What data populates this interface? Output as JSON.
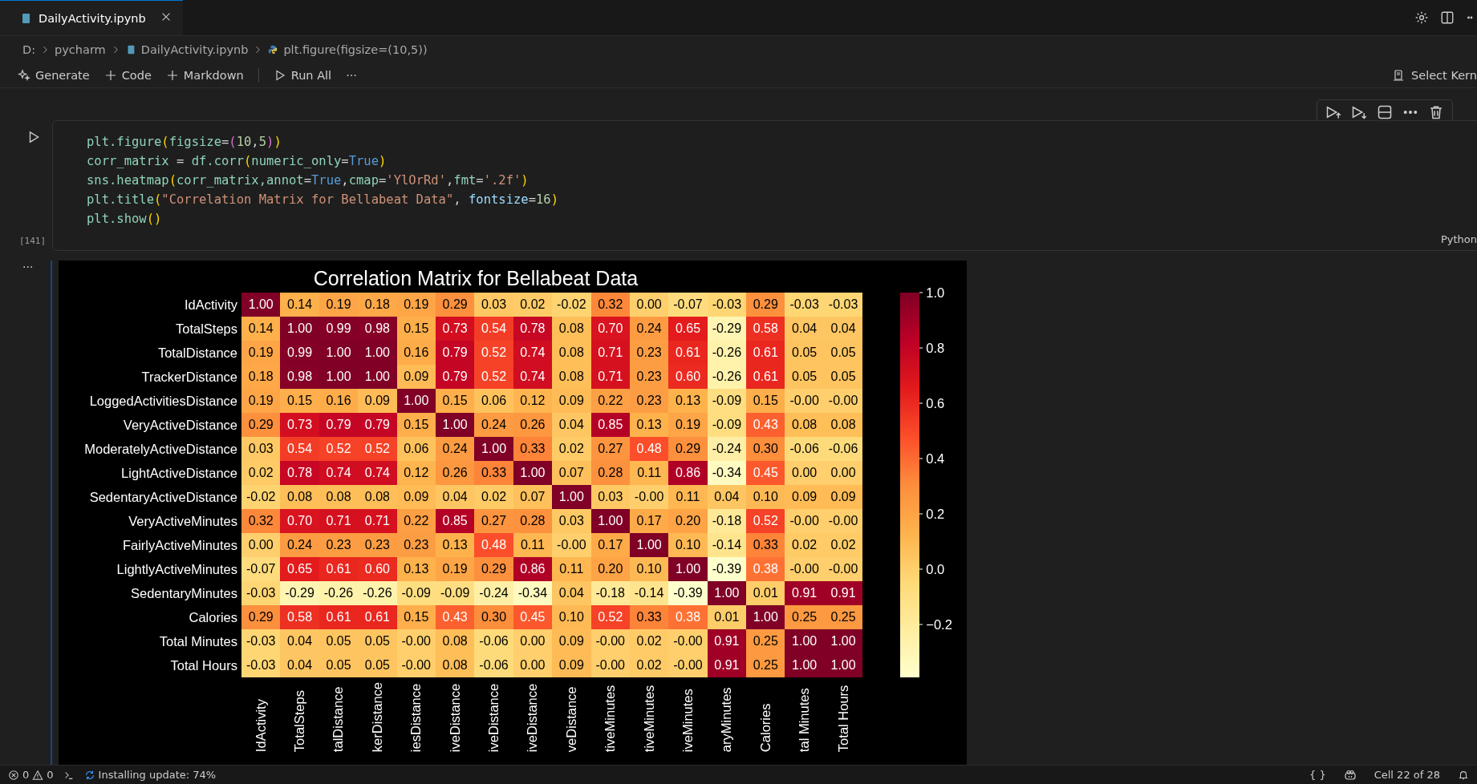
{
  "tabs": [
    {
      "label": "DailyActivity.ipynb",
      "selected": true
    }
  ],
  "breadcrumb": [
    "D:",
    "pycharm",
    "DailyActivity.ipynb",
    "plt.figure(figsize=(10,5))"
  ],
  "toolbar": {
    "items": [
      {
        "kind": "sparkle",
        "label": "Generate"
      },
      {
        "kind": "plus",
        "label": "Code"
      },
      {
        "kind": "plus",
        "label": "Markdown"
      },
      {
        "kind": "run",
        "label": "Run All"
      },
      {
        "kind": "more",
        "label": "···"
      }
    ],
    "kernel": "Select Kern"
  },
  "cell": {
    "execution_count": "[141]",
    "language": "Python",
    "code": [
      [
        {
          "kind": "ident",
          "text": "plt.figure"
        },
        {
          "kind": "paren",
          "text": "("
        },
        {
          "kind": "ident",
          "text": "figsize"
        },
        {
          "kind": "op",
          "text": "="
        },
        {
          "kind": "paren2",
          "text": "("
        },
        {
          "kind": "num",
          "text": "10"
        },
        {
          "kind": "op",
          "text": ","
        },
        {
          "kind": "num",
          "text": "5"
        },
        {
          "kind": "paren2",
          "text": ")"
        },
        {
          "kind": "paren",
          "text": ")"
        }
      ],
      [
        {
          "kind": "ident",
          "text": "corr_matrix"
        },
        {
          "kind": "op",
          "text": " = "
        },
        {
          "kind": "ident",
          "text": "df.corr"
        },
        {
          "kind": "paren",
          "text": "("
        },
        {
          "kind": "ident",
          "text": "numeric_only"
        },
        {
          "kind": "op",
          "text": "="
        },
        {
          "kind": "kw",
          "text": "True"
        },
        {
          "kind": "paren",
          "text": ")"
        }
      ],
      [
        {
          "kind": "ident",
          "text": "sns.heatmap"
        },
        {
          "kind": "paren",
          "text": "("
        },
        {
          "kind": "ident",
          "text": "corr_matrix,annot"
        },
        {
          "kind": "op",
          "text": "="
        },
        {
          "kind": "kw",
          "text": "True"
        },
        {
          "kind": "op",
          "text": ","
        },
        {
          "kind": "ident",
          "text": "cmap"
        },
        {
          "kind": "op",
          "text": "="
        },
        {
          "kind": "str",
          "text": "'YlOrRd'"
        },
        {
          "kind": "op",
          "text": ","
        },
        {
          "kind": "ident",
          "text": "fmt"
        },
        {
          "kind": "op",
          "text": "="
        },
        {
          "kind": "str",
          "text": "'.2f'"
        },
        {
          "kind": "paren",
          "text": ")"
        }
      ],
      [
        {
          "kind": "ident",
          "text": "plt.title"
        },
        {
          "kind": "paren",
          "text": "("
        },
        {
          "kind": "str",
          "text": "\"Correlation Matrix for Bellabeat Data\""
        },
        {
          "kind": "op",
          "text": ", "
        },
        {
          "kind": "param",
          "text": "fontsize"
        },
        {
          "kind": "op",
          "text": "="
        },
        {
          "kind": "num",
          "text": "16"
        },
        {
          "kind": "paren",
          "text": ")"
        }
      ],
      [
        {
          "kind": "ident",
          "text": "plt.show"
        },
        {
          "kind": "paren",
          "text": "()"
        }
      ]
    ]
  },
  "output": {
    "more": "···",
    "heatmap": {
      "title": "Correlation Matrix for Bellabeat Data",
      "rows": [
        {
          "label": "IdActivity",
          "values": [
            "1.00",
            "0.14",
            "0.19",
            "0.18",
            "0.19",
            "0.29",
            "0.03",
            "0.02",
            "-0.02",
            "0.32",
            "0.00",
            "-0.07",
            "-0.03",
            "0.29",
            "-0.03",
            "-0.03"
          ]
        },
        {
          "label": "TotalSteps",
          "values": [
            "0.14",
            "1.00",
            "0.99",
            "0.98",
            "0.15",
            "0.73",
            "0.54",
            "0.78",
            "0.08",
            "0.70",
            "0.24",
            "0.65",
            "-0.29",
            "0.58",
            "0.04",
            "0.04"
          ]
        },
        {
          "label": "TotalDistance",
          "values": [
            "0.19",
            "0.99",
            "1.00",
            "1.00",
            "0.16",
            "0.79",
            "0.52",
            "0.74",
            "0.08",
            "0.71",
            "0.23",
            "0.61",
            "-0.26",
            "0.61",
            "0.05",
            "0.05"
          ]
        },
        {
          "label": "TrackerDistance",
          "values": [
            "0.18",
            "0.98",
            "1.00",
            "1.00",
            "0.09",
            "0.79",
            "0.52",
            "0.74",
            "0.08",
            "0.71",
            "0.23",
            "0.60",
            "-0.26",
            "0.61",
            "0.05",
            "0.05"
          ]
        },
        {
          "label": "LoggedActivitiesDistance",
          "values": [
            "0.19",
            "0.15",
            "0.16",
            "0.09",
            "1.00",
            "0.15",
            "0.06",
            "0.12",
            "0.09",
            "0.22",
            "0.23",
            "0.13",
            "-0.09",
            "0.15",
            "-0.00",
            "-0.00"
          ]
        },
        {
          "label": "VeryActiveDistance",
          "values": [
            "0.29",
            "0.73",
            "0.79",
            "0.79",
            "0.15",
            "1.00",
            "0.24",
            "0.26",
            "0.04",
            "0.85",
            "0.13",
            "0.19",
            "-0.09",
            "0.43",
            "0.08",
            "0.08"
          ]
        },
        {
          "label": "ModeratelyActiveDistance",
          "values": [
            "0.03",
            "0.54",
            "0.52",
            "0.52",
            "0.06",
            "0.24",
            "1.00",
            "0.33",
            "0.02",
            "0.27",
            "0.48",
            "0.29",
            "-0.24",
            "0.30",
            "-0.06",
            "-0.06"
          ]
        },
        {
          "label": "LightActiveDistance",
          "values": [
            "0.02",
            "0.78",
            "0.74",
            "0.74",
            "0.12",
            "0.26",
            "0.33",
            "1.00",
            "0.07",
            "0.28",
            "0.11",
            "0.86",
            "-0.34",
            "0.45",
            "0.00",
            "0.00"
          ]
        },
        {
          "label": "SedentaryActiveDistance",
          "values": [
            "-0.02",
            "0.08",
            "0.08",
            "0.08",
            "0.09",
            "0.04",
            "0.02",
            "0.07",
            "1.00",
            "0.03",
            "-0.00",
            "0.11",
            "0.04",
            "0.10",
            "0.09",
            "0.09"
          ]
        },
        {
          "label": "VeryActiveMinutes",
          "values": [
            "0.32",
            "0.70",
            "0.71",
            "0.71",
            "0.22",
            "0.85",
            "0.27",
            "0.28",
            "0.03",
            "1.00",
            "0.17",
            "0.20",
            "-0.18",
            "0.52",
            "-0.00",
            "-0.00"
          ]
        },
        {
          "label": "FairlyActiveMinutes",
          "values": [
            "0.00",
            "0.24",
            "0.23",
            "0.23",
            "0.23",
            "0.13",
            "0.48",
            "0.11",
            "-0.00",
            "0.17",
            "1.00",
            "0.10",
            "-0.14",
            "0.33",
            "0.02",
            "0.02"
          ]
        },
        {
          "label": "LightlyActiveMinutes",
          "values": [
            "-0.07",
            "0.65",
            "0.61",
            "0.60",
            "0.13",
            "0.19",
            "0.29",
            "0.86",
            "0.11",
            "0.20",
            "0.10",
            "1.00",
            "-0.39",
            "0.38",
            "-0.00",
            "-0.00"
          ]
        },
        {
          "label": "SedentaryMinutes",
          "values": [
            "-0.03",
            "-0.29",
            "-0.26",
            "-0.26",
            "-0.09",
            "-0.09",
            "-0.24",
            "-0.34",
            "0.04",
            "-0.18",
            "-0.14",
            "-0.39",
            "1.00",
            "0.01",
            "0.91",
            "0.91"
          ]
        },
        {
          "label": "Calories",
          "values": [
            "0.29",
            "0.58",
            "0.61",
            "0.61",
            "0.15",
            "0.43",
            "0.30",
            "0.45",
            "0.10",
            "0.52",
            "0.33",
            "0.38",
            "0.01",
            "1.00",
            "0.25",
            "0.25"
          ]
        },
        {
          "label": "Total Minutes",
          "values": [
            "-0.03",
            "0.04",
            "0.05",
            "0.05",
            "-0.00",
            "0.08",
            "-0.06",
            "0.00",
            "0.09",
            "-0.00",
            "0.02",
            "-0.00",
            "0.91",
            "0.25",
            "1.00",
            "1.00"
          ]
        },
        {
          "label": "Total Hours",
          "values": [
            "-0.03",
            "0.04",
            "0.05",
            "0.05",
            "-0.00",
            "0.08",
            "-0.06",
            "0.00",
            "0.09",
            "-0.00",
            "0.02",
            "-0.00",
            "0.91",
            "0.25",
            "1.00",
            "1.00"
          ]
        }
      ],
      "column_labels": [
        "IdActivity",
        "TotalSteps",
        "talDistance",
        "kerDistance",
        "iesDistance",
        "iveDistance",
        "iveDistance",
        "iveDistance",
        "veDistance",
        "tiveMinutes",
        "tiveMinutes",
        "iveMinutes",
        "aryMinutes",
        "Calories",
        "tal Minutes",
        "Total Hours"
      ],
      "colorbar_ticks": [
        "1.0",
        "0.8",
        "0.6",
        "0.4",
        "0.2",
        "0.0",
        "−0.2"
      ]
    }
  },
  "status_bar": {
    "errors": "0",
    "warnings": "0",
    "update": "Installing update: 74%",
    "braces": "{ }",
    "cell_position": "Cell 22 of 28"
  }
}
